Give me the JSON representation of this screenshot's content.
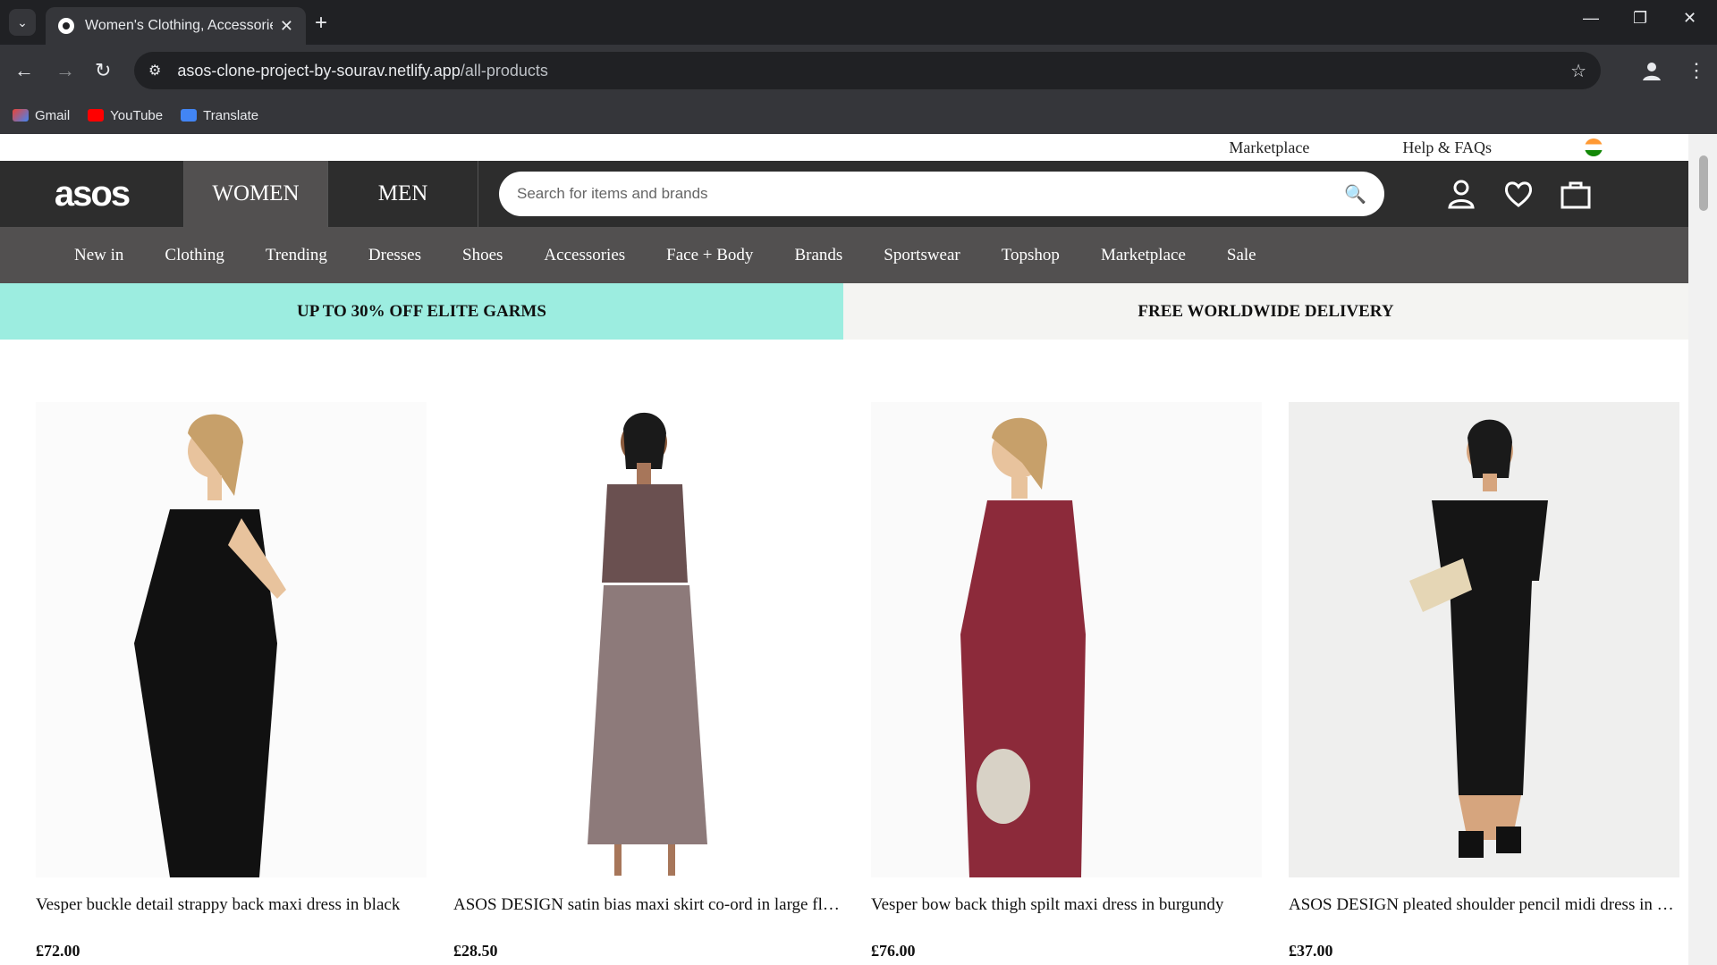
{
  "browser": {
    "tab_title": "Women's Clothing, Accessories",
    "url_host": "asos-clone-project-by-sourav.netlify.app",
    "url_path": "/all-products",
    "bookmarks": [
      "Gmail",
      "YouTube",
      "Translate"
    ]
  },
  "site": {
    "top_links": [
      "Marketplace",
      "Help & FAQs"
    ],
    "logo": "asos",
    "gender_tabs": [
      "WOMEN",
      "MEN"
    ],
    "search_placeholder": "Search for items and brands",
    "categories": [
      "New in",
      "Clothing",
      "Trending",
      "Dresses",
      "Shoes",
      "Accessories",
      "Face + Body",
      "Brands",
      "Sportswear",
      "Topshop",
      "Marketplace",
      "Sale"
    ],
    "promo_left": "UP TO 30% OFF ELITE GARMS",
    "promo_right": "FREE WORLDWIDE DELIVERY"
  },
  "products": [
    {
      "name": "Vesper buckle detail strappy back maxi dress in black",
      "price": "£72.00",
      "dress_color": "#111111"
    },
    {
      "name": "ASOS DESIGN satin bias maxi skirt co-ord in large floral print",
      "price": "£28.50",
      "dress_color": "#7b6a6a"
    },
    {
      "name": "Vesper bow back thigh spilt maxi dress in burgundy",
      "price": "£76.00",
      "dress_color": "#8c2a3a"
    },
    {
      "name": "ASOS DESIGN pleated shoulder pencil midi dress in black",
      "price": "£37.00",
      "dress_color": "#151515"
    }
  ]
}
